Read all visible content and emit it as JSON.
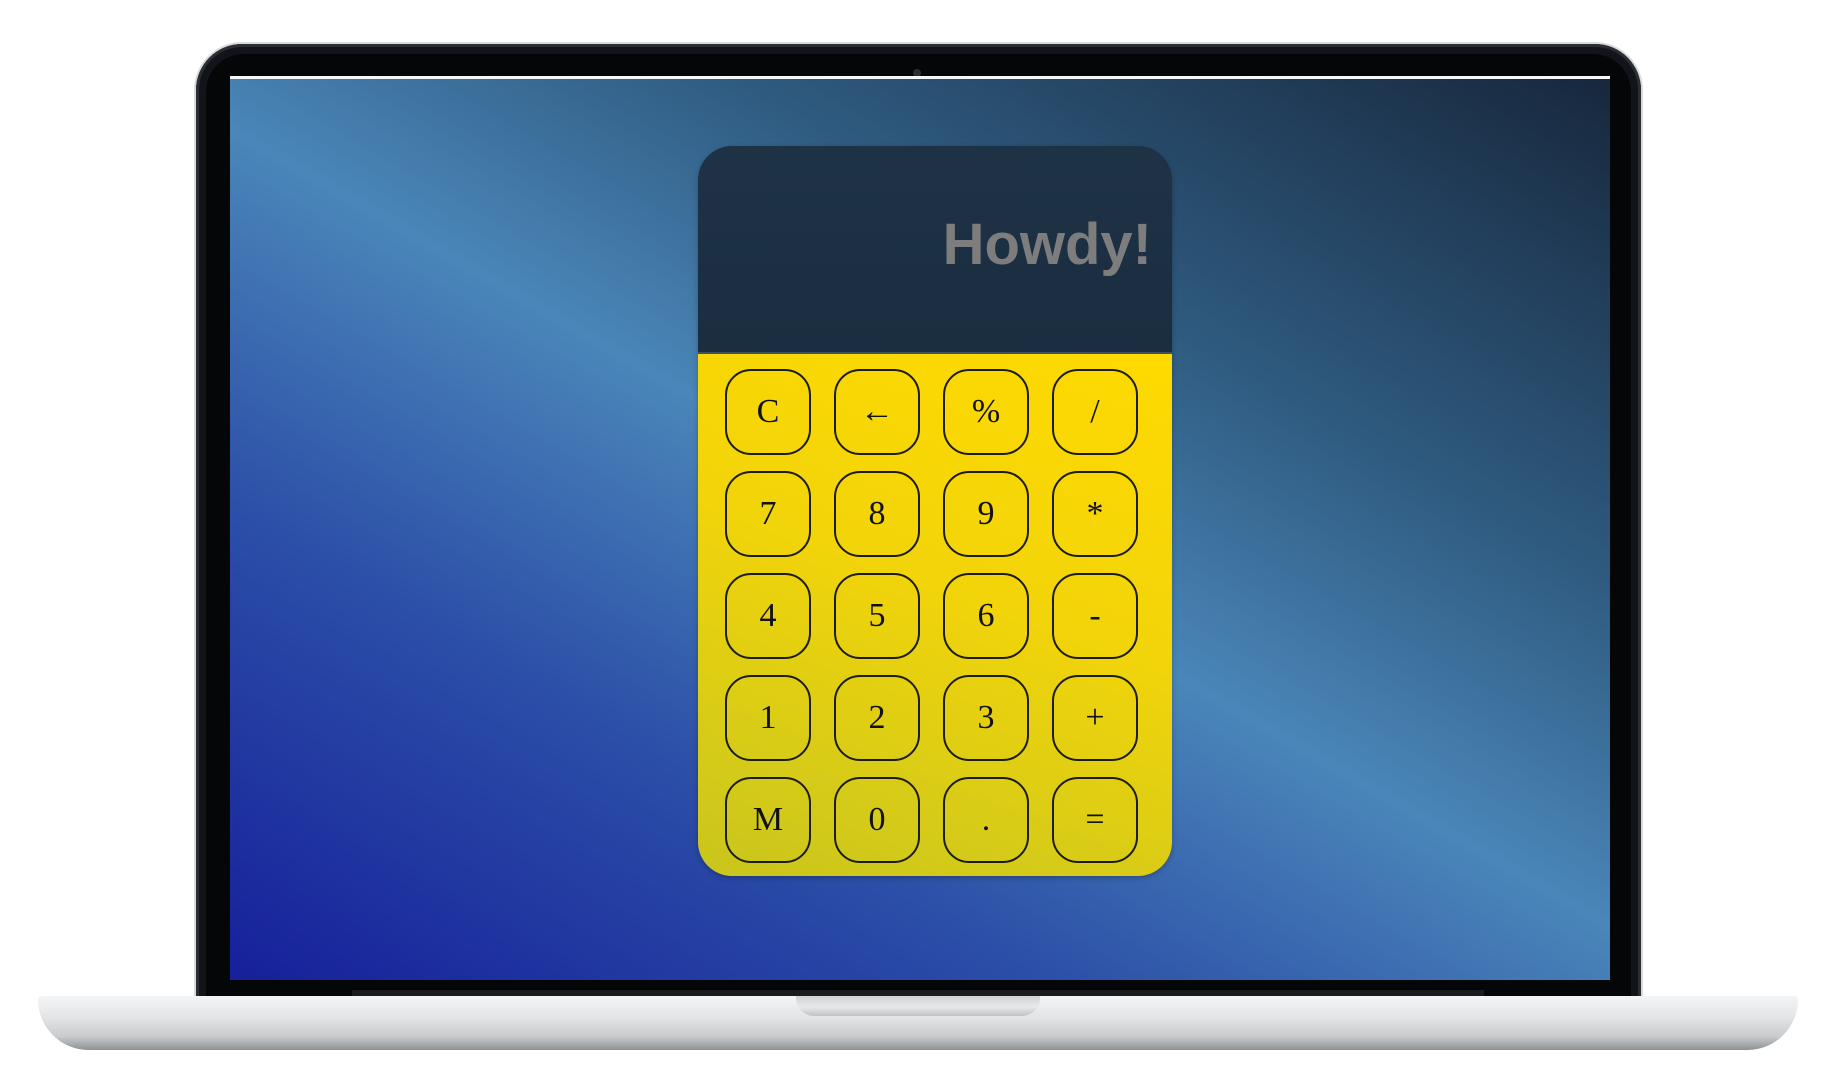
{
  "screen": {
    "background_colors": [
      "#16209a",
      "#4a86b9",
      "#17273c"
    ]
  },
  "calculator": {
    "display": "Howdy!",
    "display_color": "#7d7d7d",
    "display_background": "#1e3246",
    "keypad_color": "#ffda00",
    "keys": [
      {
        "label": "C",
        "name": "clear-button"
      },
      {
        "label": "←",
        "name": "backspace-button"
      },
      {
        "label": "%",
        "name": "percent-button"
      },
      {
        "label": "/",
        "name": "divide-button"
      },
      {
        "label": "7",
        "name": "digit-7-button"
      },
      {
        "label": "8",
        "name": "digit-8-button"
      },
      {
        "label": "9",
        "name": "digit-9-button"
      },
      {
        "label": "*",
        "name": "multiply-button"
      },
      {
        "label": "4",
        "name": "digit-4-button"
      },
      {
        "label": "5",
        "name": "digit-5-button"
      },
      {
        "label": "6",
        "name": "digit-6-button"
      },
      {
        "label": "-",
        "name": "subtract-button"
      },
      {
        "label": "1",
        "name": "digit-1-button"
      },
      {
        "label": "2",
        "name": "digit-2-button"
      },
      {
        "label": "3",
        "name": "digit-3-button"
      },
      {
        "label": "+",
        "name": "add-button"
      },
      {
        "label": "M",
        "name": "memory-button"
      },
      {
        "label": "0",
        "name": "digit-0-button"
      },
      {
        "label": ".",
        "name": "decimal-button"
      },
      {
        "label": "=",
        "name": "equals-button"
      }
    ]
  }
}
